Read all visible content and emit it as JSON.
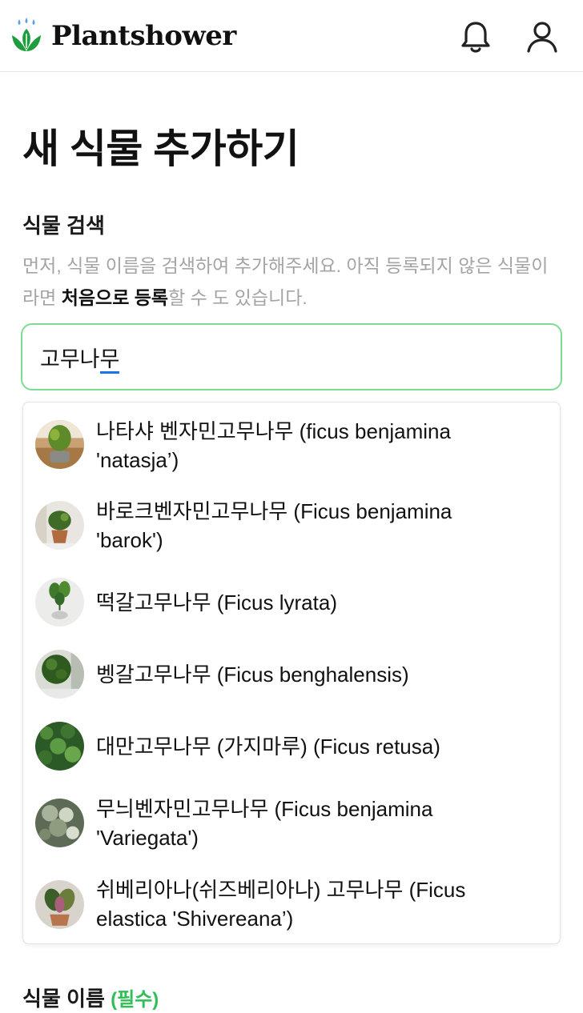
{
  "header": {
    "brand": "Plantshower",
    "logo_icon": "leaf-water-logo-icon",
    "notification_icon": "bell-icon",
    "profile_icon": "user-icon",
    "accent_color": "#2fbf55"
  },
  "page": {
    "title": "새 식물 추가하기"
  },
  "search": {
    "label": "식물 검색",
    "help_prefix": "먼저, 식물 이름을 검색하여 추가해주세요. 아직 등록되지 않은 식물이라면 ",
    "help_bold": "처음으로 등록",
    "help_suffix": "할 수 도 있습니다.",
    "value_committed": "고무나",
    "value_composing": "무",
    "border_color": "#7edc92"
  },
  "suggestions": [
    {
      "line1": "나타샤 벤자민고무나무 (ficus benjamina",
      "line2": "'natasja’)"
    },
    {
      "line1": "바로크벤자민고무나무 (Ficus benjamina",
      "line2": "'barok')"
    },
    {
      "line1": "떡갈고무나무 (Ficus lyrata)",
      "line2": ""
    },
    {
      "line1": "벵갈고무나무 (Ficus benghalensis)",
      "line2": ""
    },
    {
      "line1": "대만고무나무 (가지마루) (Ficus retusa)",
      "line2": ""
    },
    {
      "line1": "무늬벤자민고무나무 (Ficus benjamina",
      "line2": "'Variegata')"
    },
    {
      "line1": "쉬베리아나(쉬즈베리아나) 고무나무 (Ficus",
      "line2": "elastica 'Shivereana’)"
    }
  ],
  "name_field": {
    "label": "식물 이름",
    "required": "(필수)"
  }
}
